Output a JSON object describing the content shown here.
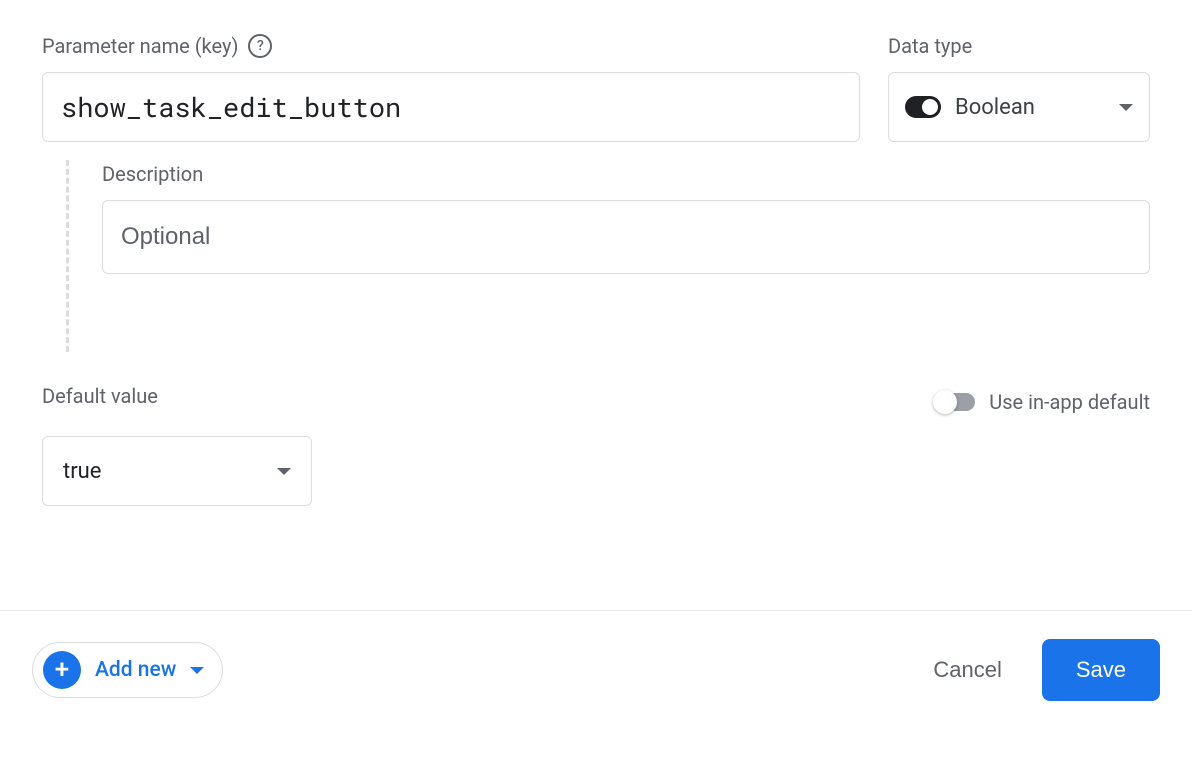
{
  "labels": {
    "parameter_name": "Parameter name (key)",
    "data_type": "Data type",
    "description": "Description",
    "default_value": "Default value",
    "use_in_app_default": "Use in-app default"
  },
  "parameter": {
    "name": "show_task_edit_button",
    "description_placeholder": "Optional",
    "description_value": ""
  },
  "data_type": {
    "selected": "Boolean"
  },
  "default": {
    "selected": "true",
    "use_in_app": false
  },
  "footer": {
    "add_new": "Add new",
    "cancel": "Cancel",
    "save": "Save"
  }
}
